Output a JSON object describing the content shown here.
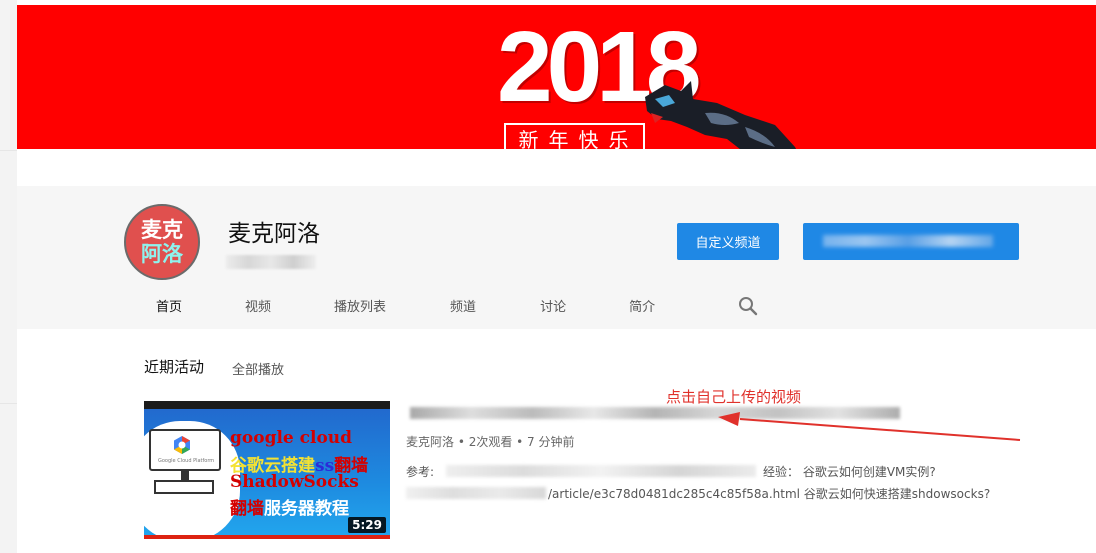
{
  "banner": {
    "year": "2018",
    "greeting": "新年快乐"
  },
  "channel": {
    "avatar_line1": "麦克",
    "avatar_line2": "阿洛",
    "name": "麦克阿洛",
    "customize_button": "自定义频道"
  },
  "tabs": [
    "首页",
    "视频",
    "播放列表",
    "频道",
    "讨论",
    "简介"
  ],
  "activity": {
    "title": "近期活动",
    "play_all": "全部播放"
  },
  "video": {
    "thumbnail": {
      "line1": "google cloud",
      "line2_a": "谷歌云搭建",
      "line2_b": "ss",
      "line2_c": "翻墙",
      "line3": "ShadowSocks",
      "line4_a": "翻墙",
      "line4_b": "服务器教程",
      "logo_text": "Google Cloud Platform",
      "duration": "5:29"
    },
    "meta": "麦克阿洛 • 2次观看 • 7 分钟前",
    "desc_prefix": "参考:",
    "desc_line1_tail": "经验： 谷歌云如何创建VM实例?",
    "desc_line2": "/article/e3c78d0481dc285c4c85f58a.html 谷歌云如何快速搭建shdowsocks?"
  },
  "annotation": "点击自己上传的视频",
  "colors": {
    "banner_red": "#ff0000",
    "button_blue": "#1f88e5",
    "annotation_red": "#e0312b"
  }
}
